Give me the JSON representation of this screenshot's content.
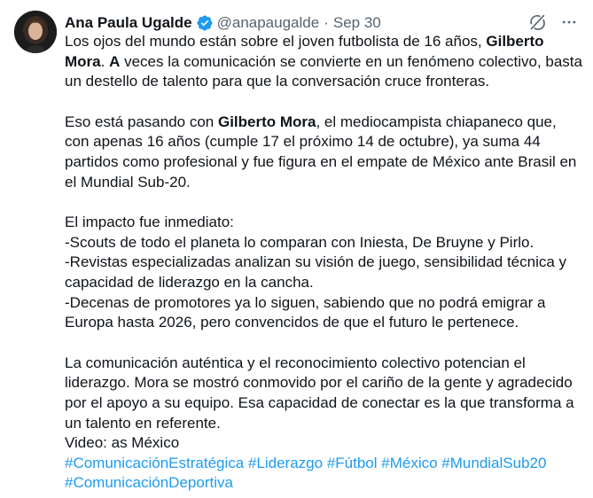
{
  "tweet": {
    "author": {
      "display_name": "Ana Paula Ugalde",
      "handle": "@anapaugalde",
      "separator": "·",
      "date": "Sep 30",
      "avatar_icon": "user-avatar-photo",
      "verified_icon": "verified-badge-icon",
      "verified_color": "#1d9bf0"
    },
    "actions": {
      "grok_icon": "grok-icon",
      "more_icon": "more-options-icon"
    },
    "p1": {
      "t1": "Los ojos del mundo están sobre el joven futbolista de 16 años, ",
      "b1": "Gilberto Mora",
      "t2": ". ",
      "b2": "A",
      "t3": " veces la comunicación se convierte en un fenómeno colectivo, basta un destello de talento para que la conversación cruce fronteras."
    },
    "p2": {
      "t1": "Eso está pasando con ",
      "b1": "Gilberto Mora",
      "t2": ", el mediocampista chiapaneco que, con apenas 16 años (cumple 17 el próximo 14 de octubre), ya suma 44 partidos como profesional y fue figura en el empate de México ante Brasil en el Mundial Sub-20."
    },
    "p3": {
      "l1": "El impacto fue inmediato:",
      "l2": "-Scouts de todo el planeta lo comparan con Iniesta, De Bruyne y Pirlo.",
      "l3": "-Revistas especializadas analizan su visión de juego, sensibilidad técnica y capacidad de liderazgo en la cancha.",
      "l4": "-Decenas de promotores ya lo siguen, sabiendo que no podrá emigrar a Europa hasta 2026, pero convencidos de que el futuro le pertenece."
    },
    "p4": {
      "l1": "La comunicación auténtica y el reconocimiento colectivo potencian el liderazgo. Mora se mostró conmovido por el cariño de la gente y agradecido por el apoyo a su equipo. Esa capacidad de conectar es la que transforma a un talento en referente.",
      "l2": "Video: as México"
    },
    "hashtags": [
      "#ComunicaciónEstratégica",
      "#Liderazgo",
      "#Fútbol",
      "#México",
      "#MundialSub20",
      "#ComunicaciónDeportiva"
    ],
    "link_color": "#1d9bf0"
  }
}
